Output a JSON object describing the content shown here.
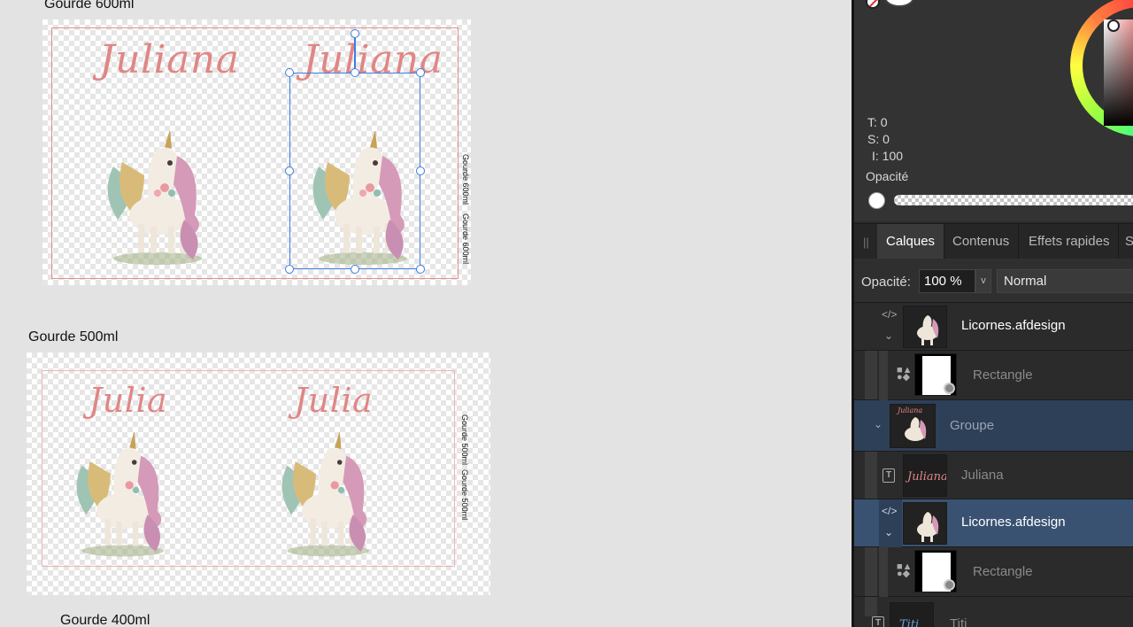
{
  "artboards": [
    {
      "title": "Gourde 600ml",
      "name_text": "Juliana",
      "vertical_label": "Gourde 600ml    Gourde 600ml"
    },
    {
      "title": "Gourde 500ml",
      "name_text": "Julia",
      "vertical_label": "Gourde 500ml  Gourde 500ml"
    },
    {
      "title": "Gourde 400ml"
    }
  ],
  "color_panel": {
    "hue": "T: 0",
    "saturation": "S: 0",
    "intensity": "I: 100",
    "opacity_label": "Opacité"
  },
  "tabs": [
    {
      "label": "Calques",
      "active": true
    },
    {
      "label": "Contenus",
      "active": false
    },
    {
      "label": "Effets rapides",
      "active": false
    },
    {
      "label": "S",
      "active": false
    }
  ],
  "layer_options": {
    "opacity_label": "Opacité:",
    "opacity_value": "100 %",
    "blend_mode": "Normal"
  },
  "layers": [
    {
      "name": "Licornes.afdesign",
      "kind": "embedded",
      "selected": false
    },
    {
      "name": "Rectangle",
      "kind": "rectangle",
      "selected": false
    },
    {
      "name": "Groupe",
      "kind": "group",
      "selected": true
    },
    {
      "name": "Juliana",
      "kind": "text",
      "thumb_text": "Juliana",
      "selected": false
    },
    {
      "name": "Licornes.afdesign",
      "kind": "embedded",
      "selected": true
    },
    {
      "name": "Rectangle",
      "kind": "rectangle",
      "selected": false
    },
    {
      "name": "Titi",
      "kind": "text",
      "thumb_text": "Titi",
      "selected": false
    }
  ],
  "colors": {
    "selection": "#3d7ee0",
    "guide": "#e58f8f",
    "script_text": "#e08686",
    "layer_selected": "#3a5272",
    "group_selected": "#2e3f58"
  }
}
